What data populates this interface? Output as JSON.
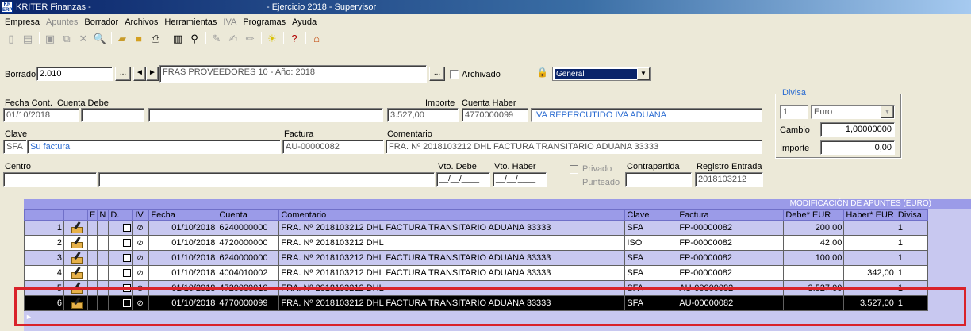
{
  "window": {
    "app_title": "KRITER Finanzas -",
    "subtitle": "- Ejercicio 2018 - Supervisor",
    "logo_text": "KR ERP"
  },
  "menu": [
    "Empresa",
    "Apuntes",
    "Borrador",
    "Archivos",
    "Herramientas",
    "IVA",
    "Programas",
    "Ayuda"
  ],
  "menu_disabled": [
    "Apuntes",
    "IVA"
  ],
  "toolbar_icons": [
    "new-doc-icon",
    "blank-doc-icon",
    "save-icon",
    "copy-icon",
    "delete-icon",
    "preview-icon",
    "open-folder-icon",
    "folder-icon",
    "print-icon",
    "book-icon",
    "binoculars-icon",
    "edit-pen-icon",
    "edit-pen2-icon",
    "edit-pen3-icon",
    "lightbulb-icon",
    "help-icon",
    "home-icon"
  ],
  "borrador": {
    "label": "Borrador",
    "value": "2.010",
    "dots": "...",
    "prev": "◄",
    "next": "►",
    "description": "FRAS PROVEEDORES 10 - Año: 2018",
    "dots2": "...",
    "archivado_label": "Archivado",
    "lock": "🔒",
    "select_value": "General",
    "select_arrow": "▼"
  },
  "form": {
    "fecha_label": "Fecha Cont.",
    "fecha_value": "01/10/2018",
    "cuenta_debe_label": "Cuenta Debe",
    "cuenta_debe_value": "",
    "cuenta_debe_desc": "",
    "importe_label": "Importe",
    "importe_value": "3.527,00",
    "cuenta_haber_label": "Cuenta Haber",
    "cuenta_haber_value": "4770000099",
    "cuenta_haber_desc": "IVA REPERCUTIDO IVA ADUANA",
    "clave_label": "Clave",
    "clave_value": "SFA",
    "clave_desc": "Su factura",
    "factura_label": "Factura",
    "factura_value": "AU-00000082",
    "comentario_label": "Comentario",
    "comentario_value": "FRA. Nº 2018103212 DHL FACTURA TRANSITARIO ADUANA 33333",
    "centro_label": "Centro",
    "centro_value": "",
    "centro_desc": "",
    "vto_debe_label": "Vto. Debe",
    "vto_debe_value": "__/__/____",
    "vto_haber_label": "Vto. Haber",
    "vto_haber_value": "__/__/____",
    "privado_label": "Privado",
    "punteado_label": "Punteado",
    "contrapartida_label": "Contrapartida",
    "contrapartida_value": "",
    "registro_label": "Registro Entrada",
    "registro_value": "2018103212"
  },
  "divisa": {
    "legend": "Divisa",
    "code": "1",
    "name": "Euro",
    "arrow": "▼",
    "cambio_label": "Cambio",
    "cambio_value": "1,00000000",
    "importe_label": "Importe",
    "importe_value": "0,00"
  },
  "grid": {
    "caption": "MODIFICACIÓN DE APUNTES (EURO)",
    "columns": [
      "",
      "E",
      "N",
      "D.",
      "",
      "IV",
      "Fecha",
      "Cuenta",
      "Comentario",
      "Clave",
      "Factura",
      "Debe* EUR",
      "Haber* EUR",
      "Divisa"
    ],
    "rows": [
      {
        "n": "1",
        "fecha": "01/10/2018",
        "cuenta": "6240000000",
        "comentario": "FRA. Nº 2018103212 DHL FACTURA TRANSITARIO ADUANA 33333",
        "clave": "SFA",
        "factura": "FP-00000082",
        "debe": "200,00",
        "haber": "",
        "divisa": "1",
        "style": "lilac"
      },
      {
        "n": "2",
        "fecha": "01/10/2018",
        "cuenta": "4720000000",
        "comentario": "FRA. Nº 2018103212 DHL",
        "clave": "ISO",
        "factura": "FP-00000082",
        "debe": "42,00",
        "haber": "",
        "divisa": "1",
        "style": "light"
      },
      {
        "n": "3",
        "fecha": "01/10/2018",
        "cuenta": "6240000000",
        "comentario": "FRA. Nº 2018103212 DHL FACTURA TRANSITARIO ADUANA 33333",
        "clave": "SFA",
        "factura": "FP-00000082",
        "debe": "100,00",
        "haber": "",
        "divisa": "1",
        "style": "lilac"
      },
      {
        "n": "4",
        "fecha": "01/10/2018",
        "cuenta": "4004010002",
        "comentario": "FRA. Nº 2018103212 DHL FACTURA TRANSITARIO ADUANA 33333",
        "clave": "SFA",
        "factura": "FP-00000082",
        "debe": "",
        "haber": "342,00",
        "divisa": "1",
        "style": "light"
      },
      {
        "n": "5",
        "fecha": "01/10/2018",
        "cuenta": "4720000010",
        "comentario": "FRA. Nº 2018103212 DHL",
        "clave": "SFA",
        "factura": "AU-00000082",
        "debe": "3.527,00",
        "haber": "",
        "divisa": "1",
        "style": "lilac"
      },
      {
        "n": "6",
        "fecha": "01/10/2018",
        "cuenta": "4770000099",
        "comentario": "FRA. Nº 2018103212 DHL FACTURA TRANSITARIO ADUANA 33333",
        "clave": "SFA",
        "factura": "AU-00000082",
        "debe": "",
        "haber": "3.527,00",
        "divisa": "1",
        "style": "selected"
      }
    ],
    "current_row_marker": "►"
  },
  "colors": {
    "highlight": "#d9232a",
    "grid_header": "#9b9be8",
    "grid_lilac": "#c8c8f0",
    "link_blue": "#2a6bd1"
  }
}
